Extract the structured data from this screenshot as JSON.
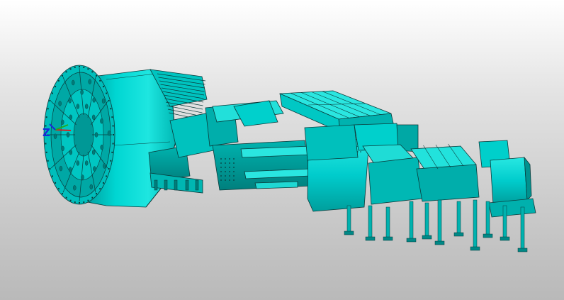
{
  "viewport": {
    "background_top": "#ffffff",
    "background_bottom": "#b9b9b9"
  },
  "model": {
    "body_color": "#00cccc",
    "light_color": "#1ee6e0",
    "shadow_color": "#009a9a",
    "edge_color": "#0b3a3a"
  },
  "triad": {
    "z_label": "Z",
    "z_color": "#1a2bd8",
    "y_color": "#22aa22",
    "x_color": "#d82020"
  }
}
